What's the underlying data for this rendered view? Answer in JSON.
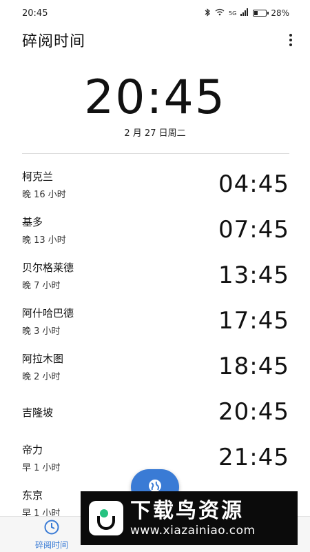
{
  "status_bar": {
    "time": "20:45",
    "network": "5G",
    "battery": "28%",
    "battery_level": 0.28
  },
  "app_bar": {
    "title": "碎阅时间"
  },
  "main_clock": {
    "time": "20:45",
    "date": "2 月 27 日周二"
  },
  "cities": [
    {
      "name": "柯克兰",
      "offset": "晚 16 小时",
      "time": "04:45"
    },
    {
      "name": "基多",
      "offset": "晚 13 小时",
      "time": "07:45"
    },
    {
      "name": "贝尔格莱德",
      "offset": "晚 7 小时",
      "time": "13:45"
    },
    {
      "name": "阿什哈巴德",
      "offset": "晚 3 小时",
      "time": "17:45"
    },
    {
      "name": "阿拉木图",
      "offset": "晚 2 小时",
      "time": "18:45"
    },
    {
      "name": "吉隆坡",
      "offset": "",
      "time": "20:45"
    },
    {
      "name": "帝力",
      "offset": "早 1 小时",
      "time": "21:45"
    },
    {
      "name": "东京",
      "offset": "早 1 小时",
      "time": ""
    }
  ],
  "bottom_nav": {
    "items": [
      {
        "label": "碎阅时间",
        "icon": "clock-icon",
        "active": true
      }
    ]
  },
  "fab": {
    "icon": "globe-icon",
    "color": "#3a7bd5"
  },
  "watermark": {
    "title": "下载鸟资源",
    "url": "www.xiazainiao.com"
  },
  "colors": {
    "accent": "#3a7bd5",
    "text": "#111111",
    "divider": "#dddddd"
  }
}
